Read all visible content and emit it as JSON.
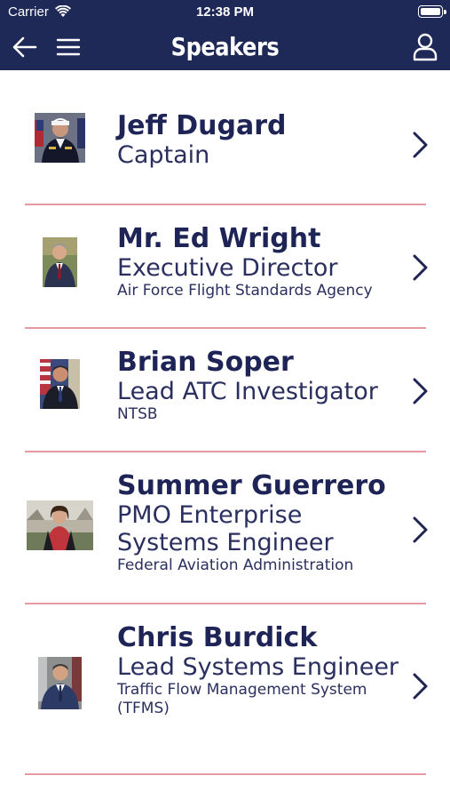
{
  "status_bar": {
    "carrier": "Carrier",
    "time": "12:38 PM"
  },
  "nav": {
    "title": "Speakers",
    "back_icon": "back-arrow-icon",
    "menu_icon": "hamburger-menu-icon",
    "profile_icon": "user-icon"
  },
  "colors": {
    "header": "#1f2958",
    "text": "#1e2456",
    "divider": "#e59aa2"
  },
  "speakers": [
    {
      "name": "Jeff Dugard",
      "title": "Captain",
      "organization": ""
    },
    {
      "name": "Mr. Ed Wright",
      "title": "Executive Director",
      "organization": "Air Force Flight Standards Agency"
    },
    {
      "name": "Brian Soper",
      "title": "Lead ATC Investigator",
      "organization": "NTSB"
    },
    {
      "name": "Summer Guerrero",
      "title": "PMO Enterprise Systems Engineer",
      "organization": "Federal Aviation Administration"
    },
    {
      "name": "Chris Burdick",
      "title": "Lead Systems Engineer",
      "organization": "Traffic Flow Management System (TFMS)"
    }
  ]
}
